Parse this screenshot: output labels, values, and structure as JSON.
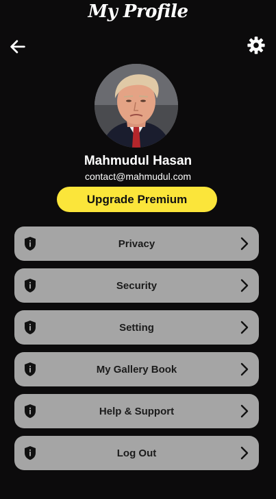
{
  "header": {
    "title": "My Profile",
    "back_icon": "arrow-left-icon",
    "settings_icon": "gear-icon"
  },
  "profile": {
    "name": "Mahmudul Hasan",
    "email": "contact@mahmudul.com",
    "upgrade_label": "Upgrade Premium"
  },
  "menu": {
    "items": [
      {
        "label": "Privacy",
        "icon": "shield-icon"
      },
      {
        "label": "Security",
        "icon": "shield-icon"
      },
      {
        "label": "Setting",
        "icon": "shield-icon"
      },
      {
        "label": "My Gallery Book",
        "icon": "shield-icon"
      },
      {
        "label": "Help & Support",
        "icon": "shield-icon"
      },
      {
        "label": "Log Out",
        "icon": "shield-icon"
      }
    ]
  },
  "colors": {
    "background": "#0c0b0c",
    "accent": "#fbe53a",
    "menu_item": "#a5a5a5",
    "menu_text": "#1b1b1b"
  }
}
